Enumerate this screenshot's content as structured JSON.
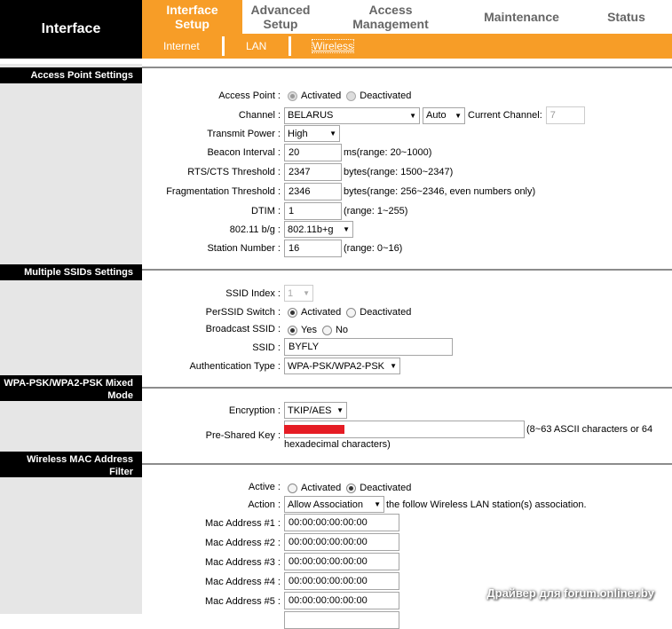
{
  "brand": "Interface",
  "topnav": [
    {
      "label": "Interface\nSetup",
      "active": true
    },
    {
      "label": "Advanced\nSetup"
    },
    {
      "label": "Access\nManagement"
    },
    {
      "label": "Maintenance"
    },
    {
      "label": "Status"
    }
  ],
  "subnav": [
    {
      "label": "Internet"
    },
    {
      "label": "LAN"
    },
    {
      "label": "Wireless",
      "active": true
    }
  ],
  "sections": {
    "ap": "Access Point Settings",
    "mssid": "Multiple SSIDs Settings",
    "wpa": "WPA-PSK/WPA2-PSK Mixed Mode",
    "mac": "Wireless MAC Address Filter"
  },
  "ap": {
    "access_point": {
      "label": "Access Point :",
      "opt1": "Activated",
      "opt2": "Deactivated"
    },
    "channel": {
      "label": "Channel :",
      "country": "BELARUS",
      "mode": "Auto",
      "current_label": "Current Channel:",
      "current_value": "7"
    },
    "tx_power": {
      "label": "Transmit Power :",
      "value": "High"
    },
    "beacon": {
      "label": "Beacon Interval :",
      "value": "20",
      "hint": "ms(range: 20~1000)"
    },
    "rts": {
      "label": "RTS/CTS Threshold :",
      "value": "2347",
      "hint": "bytes(range: 1500~2347)"
    },
    "frag": {
      "label": "Fragmentation Threshold :",
      "value": "2346",
      "hint": "bytes(range: 256~2346, even numbers only)"
    },
    "dtim": {
      "label": "DTIM :",
      "value": "1",
      "hint": "(range: 1~255)"
    },
    "mode": {
      "label": "802.11 b/g :",
      "value": "802.11b+g"
    },
    "station": {
      "label": "Station Number :",
      "value": "16",
      "hint": "(range: 0~16)"
    }
  },
  "mssid": {
    "index": {
      "label": "SSID Index :",
      "value": "1"
    },
    "switch": {
      "label": "PerSSID Switch :",
      "opt1": "Activated",
      "opt2": "Deactivated"
    },
    "broadcast": {
      "label": "Broadcast SSID :",
      "opt1": "Yes",
      "opt2": "No"
    },
    "ssid": {
      "label": "SSID :",
      "value": "BYFLY"
    },
    "auth": {
      "label": "Authentication Type :",
      "value": "WPA-PSK/WPA2-PSK"
    }
  },
  "wpa": {
    "encryption": {
      "label": "Encryption :",
      "value": "TKIP/AES"
    },
    "psk": {
      "label": "Pre-Shared Key :",
      "hint1": "(8~63 ASCII characters or 64",
      "hint2": "hexadecimal characters)"
    }
  },
  "mac": {
    "active": {
      "label": "Active :",
      "opt1": "Activated",
      "opt2": "Deactivated"
    },
    "action": {
      "label": "Action :",
      "value": "Allow Association",
      "tail": "the follow Wireless LAN station(s) association."
    },
    "addresses": [
      {
        "label": "Mac Address #1 :",
        "value": "00:00:00:00:00:00"
      },
      {
        "label": "Mac Address #2 :",
        "value": "00:00:00:00:00:00"
      },
      {
        "label": "Mac Address #3 :",
        "value": "00:00:00:00:00:00"
      },
      {
        "label": "Mac Address #4 :",
        "value": "00:00:00:00:00:00"
      },
      {
        "label": "Mac Address #5 :",
        "value": "00:00:00:00:00:00"
      }
    ]
  },
  "watermark": "Драйвер для forum.onliner.by",
  "colors": {
    "accent": "#f79d27",
    "brand_bg": "#000000",
    "left_bg": "#e6e6e6",
    "key_redaction": "#e51c24"
  }
}
